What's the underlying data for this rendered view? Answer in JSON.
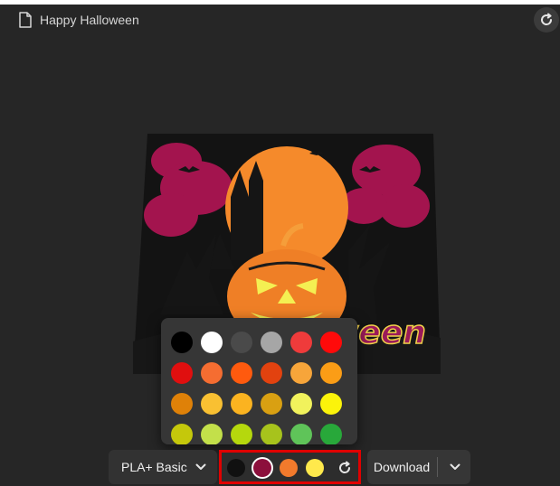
{
  "app": {
    "title": "Happy Halloween"
  },
  "artwork": {
    "caption": "ween"
  },
  "palette": {
    "colors": [
      "#000000",
      "#ffffff",
      "#4a4a4a",
      "#a6a6a6",
      "#ef3b3b",
      "#ff0a0a",
      "#e00f0f",
      "#f56d31",
      "#ff5a0e",
      "#e2420f",
      "#f7a53a",
      "#fb9d16",
      "#df8108",
      "#f9c032",
      "#fbb320",
      "#d9a012",
      "#f1f25c",
      "#fbf30a",
      "#c5c80b",
      "#c3e04a",
      "#b5d80d",
      "#a7c31c",
      "#5fc459",
      "#28a83a"
    ]
  },
  "toolbar": {
    "material_label": "PLA+ Basic",
    "selected_colors": [
      "#111111",
      "#8c103c",
      "#f27a2c",
      "#ffe94c"
    ],
    "selected_index": 1,
    "download_label": "Download"
  },
  "accent": {
    "highlight": "#e00000"
  }
}
